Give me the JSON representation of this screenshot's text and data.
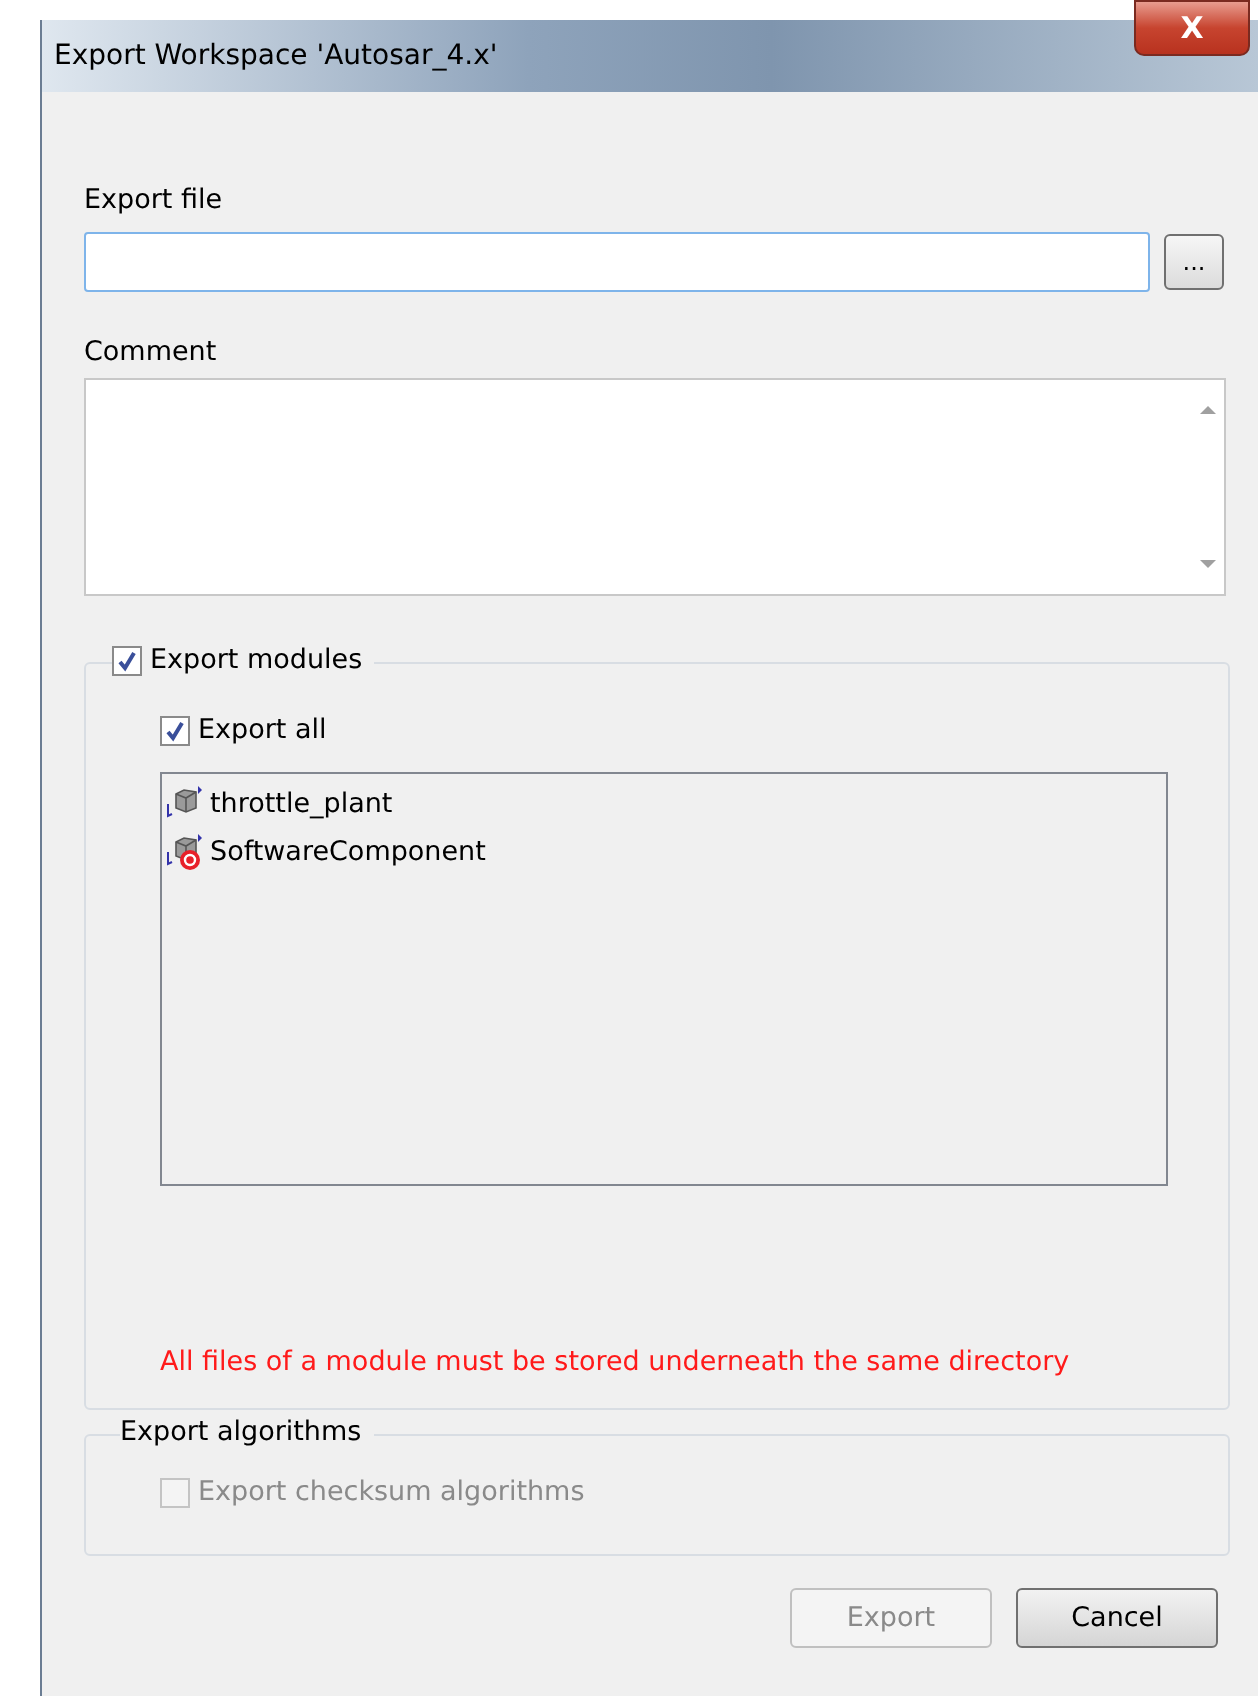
{
  "window": {
    "title": "Export Workspace 'Autosar_4.x'",
    "close": "X"
  },
  "export_file": {
    "label": "Export file",
    "browse": "..."
  },
  "comment": {
    "label": "Comment"
  },
  "modules_group": {
    "label": "Export modules",
    "checked": true,
    "export_all": {
      "label": "Export all",
      "checked": true
    },
    "items": [
      {
        "name": "throttle_plant",
        "kind": "module"
      },
      {
        "name": "SoftwareComponent",
        "kind": "error"
      }
    ],
    "warning": "All files of a module must be stored underneath the same directory"
  },
  "algorithms_group": {
    "label": "Export algorithms",
    "checksum": {
      "label": "Export checksum algorithms",
      "checked": false,
      "disabled": true
    }
  },
  "buttons": [
    {
      "label": "Export",
      "disabled": true
    },
    {
      "label": "Cancel",
      "disabled": false
    }
  ]
}
